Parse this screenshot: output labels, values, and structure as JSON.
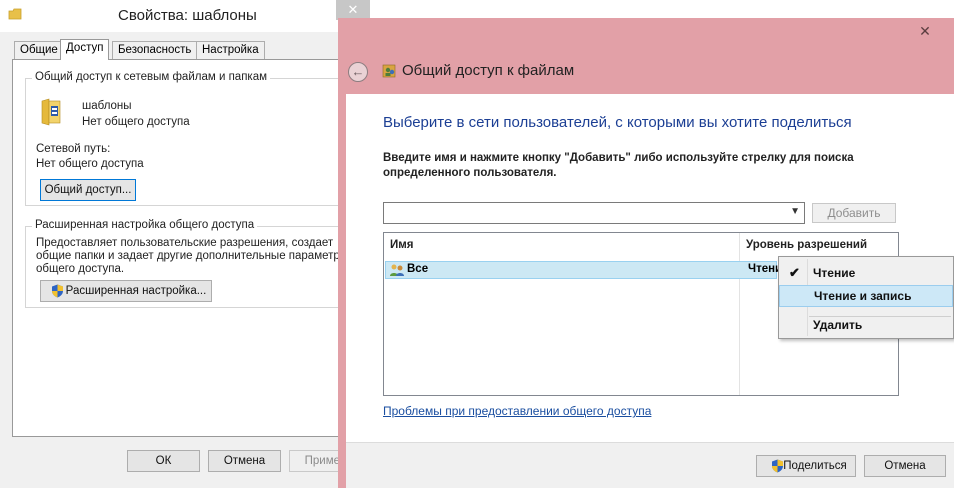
{
  "props_window": {
    "title": "Свойства: шаблоны",
    "close_glyph": "✕",
    "tabs": [
      "Общие",
      "Доступ",
      "Безопасность",
      "Настройка"
    ],
    "active_tab": 1,
    "network_group": {
      "title": "Общий доступ к сетевым файлам и папкам",
      "folder_name": "шаблоны",
      "folder_status": "Нет общего доступа",
      "network_path_label": "Сетевой путь:",
      "network_path_value": "Нет общего доступа",
      "share_button": "Общий доступ..."
    },
    "advanced_group": {
      "title": "Расширенная настройка общего доступа",
      "description_lines": [
        "Предоставляет пользовательские разрешения, создает",
        "общие папки и задает другие дополнительные параметры",
        "общего доступа."
      ],
      "advanced_button": "Расширенная настройка..."
    },
    "buttons": {
      "ok": "ОК",
      "cancel": "Отмена",
      "apply": "Примен"
    }
  },
  "share_dialog": {
    "close_glyph": "✕",
    "title": "Общий доступ к файлам",
    "heading": "Выберите в сети пользователей, с которыми вы хотите поделиться",
    "instruction": "Введите имя и нажмите кнопку \"Добавить\" либо используйте стрелку для поиска определенного пользователя.",
    "combo_value": "",
    "add_button": "Добавить",
    "table": {
      "columns": [
        "Имя",
        "Уровень разрешений"
      ],
      "rows": [
        {
          "name": "Все",
          "permission": "Чтение"
        }
      ]
    },
    "context_menu": {
      "items": [
        {
          "label": "Чтение",
          "checked": true
        },
        {
          "label": "Чтение и запись",
          "checked": false,
          "highlighted": true
        },
        {
          "label": "Удалить",
          "checked": false
        }
      ]
    },
    "help_link": "Проблемы при предоставлении общего доступа",
    "buttons": {
      "share": "Поделиться",
      "cancel": "Отмена"
    }
  },
  "colors": {
    "dialog_frame": "#e2a0a7",
    "heading_blue": "#1c3f94",
    "selection": "#cce8f4",
    "link": "#1a4ea0"
  }
}
